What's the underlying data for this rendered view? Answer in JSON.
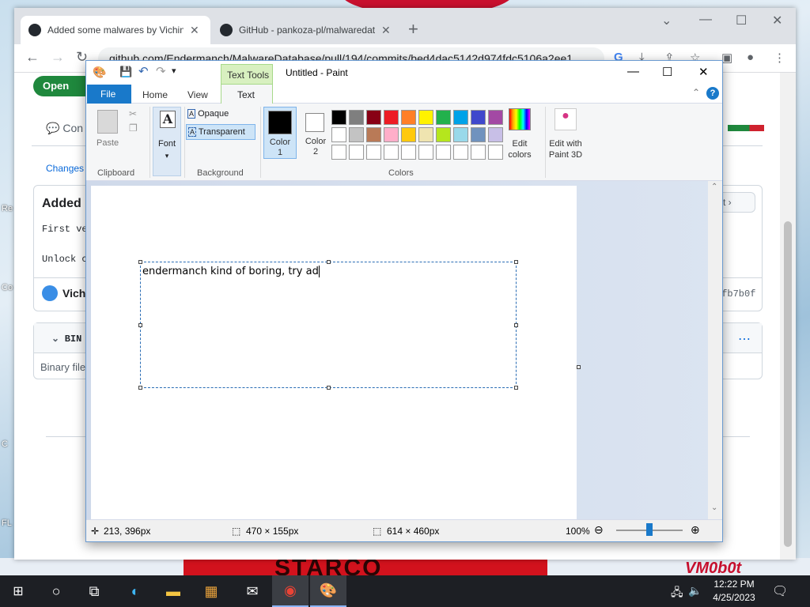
{
  "desktop": {
    "icon_labels": [
      "Re",
      "Co",
      "C",
      "FL"
    ],
    "wallpaper_text": "STARCO",
    "watermark": "VM0b0t"
  },
  "chrome": {
    "tabs": [
      {
        "title": "Added some malwares by Vichin"
      },
      {
        "title": "GitHub - pankoza-pl/malwaredat"
      }
    ],
    "url": "github.com/Endermanch/MalwareDatabase/pull/194/commits/bed4dac5142d974fdc5106a2ee1..."
  },
  "github": {
    "open_badge": "Open",
    "conversation_tab": "Con",
    "changes_link": "Changes f",
    "commit_title": "Added",
    "body_line1": "First ve",
    "body_line2": "Unlock c",
    "author": "Vichi",
    "sha_tail": "afb7b0f",
    "next_button": "xt",
    "file_header": "BIN",
    "binary_note": "Binary file"
  },
  "paint": {
    "contextual_tab": "Text Tools",
    "window_title": "Untitled - Paint",
    "tabs": {
      "file": "File",
      "home": "Home",
      "view": "View",
      "text": "Text"
    },
    "clipboard": {
      "paste": "Paste",
      "group": "Clipboard"
    },
    "font": {
      "label": "Font"
    },
    "background": {
      "opaque": "Opaque",
      "transparent": "Transparent",
      "group": "Background"
    },
    "colors": {
      "color1": "Color",
      "color1_num": "1",
      "color2": "Color",
      "color2_num": "2",
      "edit": "Edit",
      "edit2": "colors",
      "paint3d": "Edit with",
      "paint3d2": "Paint 3D",
      "group": "Colors",
      "palette": [
        "#000000",
        "#7f7f7f",
        "#880015",
        "#ed1c24",
        "#ff7f27",
        "#fff200",
        "#22b14c",
        "#00a2e8",
        "#3f48cc",
        "#a349a4",
        "#ffffff",
        "#c3c3c3",
        "#b97a57",
        "#ffaec9",
        "#ffc90e",
        "#efe4b0",
        "#b5e61d",
        "#99d9ea",
        "#7092be",
        "#c8bfe7"
      ]
    },
    "typed_text": "endermanch kind of boring, try ad",
    "status": {
      "cursor": "213, 396px",
      "selection": "470 × 155px",
      "canvas": "614 × 460px",
      "zoom": "100%"
    }
  },
  "taskbar": {
    "time": "12:22 PM",
    "date": "4/25/2023"
  }
}
